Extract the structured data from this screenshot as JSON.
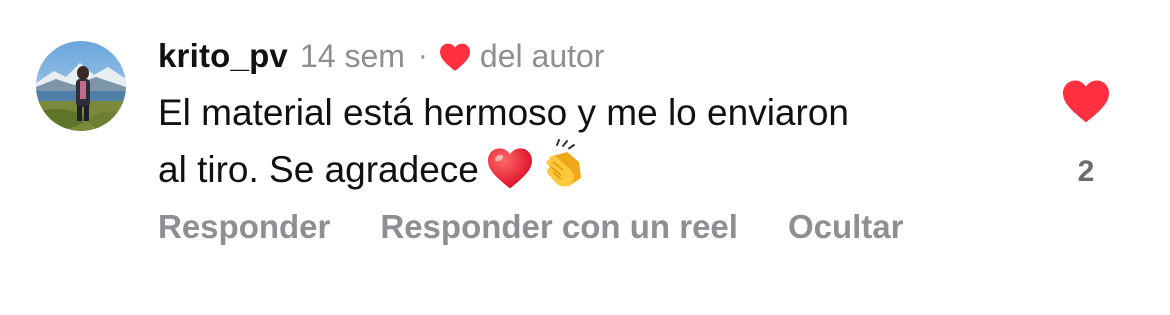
{
  "comment": {
    "username": "krito_pv",
    "time_ago": "14 sem",
    "separator": "·",
    "author_like_label": "del autor",
    "text_line1": "El material está hermoso y me lo enviaron",
    "text_line2": "al tiro. Se agradece",
    "emojis": [
      "red-heart",
      "clapping-hands"
    ],
    "like_count": "2",
    "like_icon": "heart-filled-icon",
    "like_color": "#ff3040",
    "actions": {
      "reply": "Responder",
      "reply_with_reel": "Responder con un reel",
      "hide": "Ocultar"
    }
  },
  "colors": {
    "primary_text": "#111111",
    "secondary_text": "#8e8e93",
    "heart_red": "#ff3040"
  }
}
